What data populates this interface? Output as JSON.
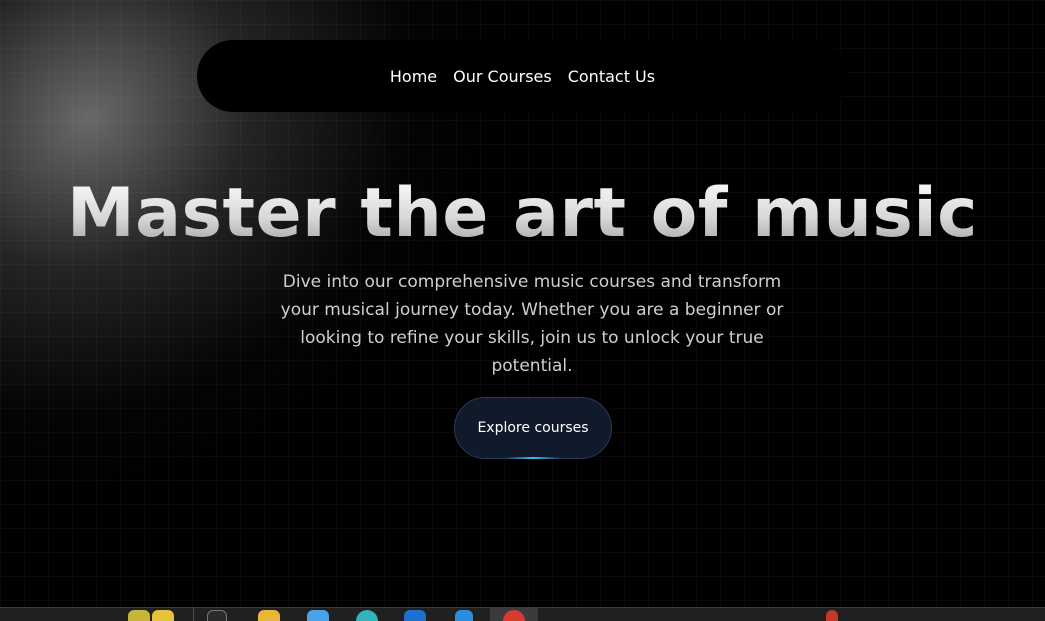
{
  "nav": {
    "items": [
      "Home",
      "Our Courses",
      "Contact Us"
    ]
  },
  "hero": {
    "title": "Master the art of music",
    "description": "Dive into our comprehensive music courses and transform your musical journey today. Whether you are a beginner or looking to refine your skills, join us to unlock your true potential.",
    "cta_label": "Explore courses"
  },
  "colors": {
    "background": "#000000",
    "cta_background": "#111a2b",
    "cta_accent": "#38bdf8",
    "text_primary": "#ffffff",
    "text_secondary": "#cfcfcf"
  },
  "taskbar": {
    "icons": [
      "lemon-icon",
      "file-explorer-icon",
      "folder-icon",
      "store-icon",
      "edge-icon",
      "mail-icon",
      "vscode-icon",
      "chrome-icon",
      "notification-icon"
    ]
  }
}
